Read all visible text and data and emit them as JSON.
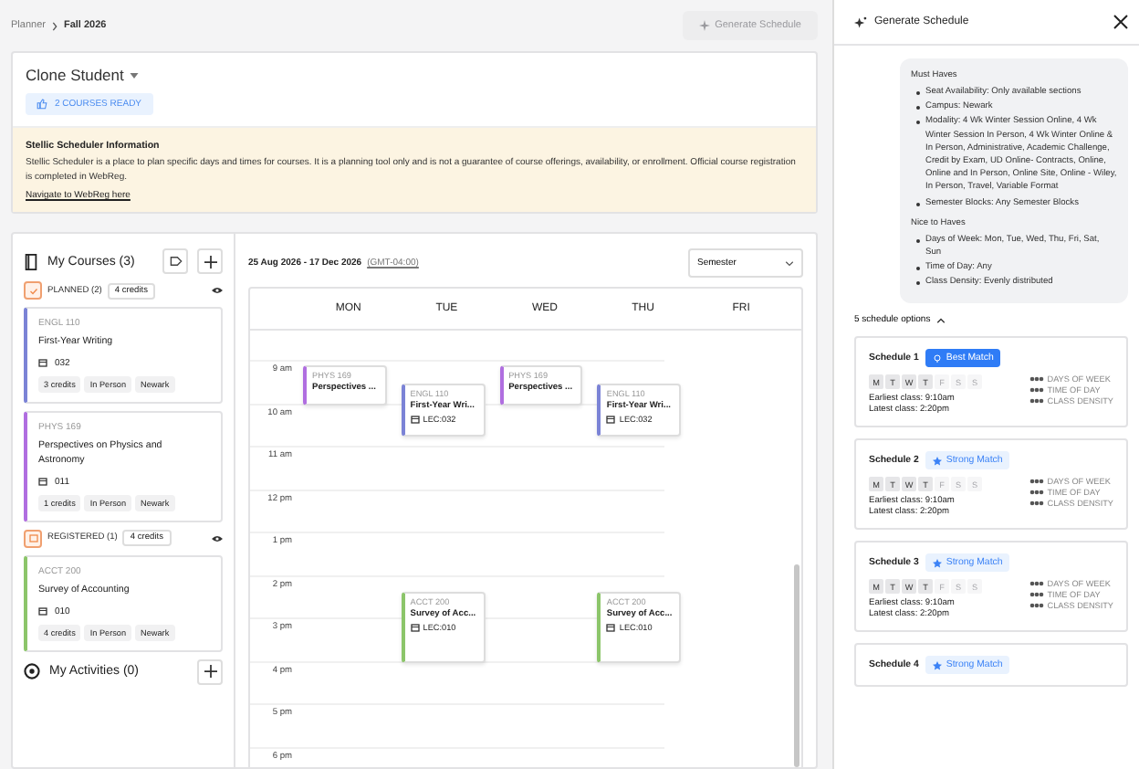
{
  "breadcrumb": {
    "parent": "Planner",
    "current": "Fall 2026"
  },
  "generate_button": {
    "label": "Generate Schedule",
    "disabled": true
  },
  "student": {
    "name": "Clone Student",
    "badge": "2 COURSES READY"
  },
  "info": {
    "title": "Stellic Scheduler Information",
    "text": "Stellic Scheduler is a place to plan specific days and times for courses. It is a planning tool only and is not a guarantee of course offerings, availability, or enrollment. Official course registration is completed in WebReg.",
    "link": "Navigate to WebReg here"
  },
  "my_courses": {
    "title": "My Courses (3)",
    "groups": [
      {
        "kind": "planned",
        "label": "PLANNED (2)",
        "credits": "4 credits",
        "visible": true,
        "courses": [
          {
            "code": "ENGL 110",
            "title": "First-Year Writing",
            "section": "032",
            "tags": [
              "3 credits",
              "In Person",
              "Newark"
            ],
            "color": "#7b83d6"
          },
          {
            "code": "PHYS 169",
            "title": "Perspectives on Physics and Astronomy",
            "section": "011",
            "tags": [
              "1 credits",
              "In Person",
              "Newark"
            ],
            "color": "#b06ee0"
          }
        ]
      },
      {
        "kind": "registered",
        "label": "REGISTERED (1)",
        "credits": "4 credits",
        "visible": true,
        "courses": [
          {
            "code": "ACCT 200",
            "title": "Survey of Accounting",
            "section": "010",
            "tags": [
              "4 credits",
              "In Person",
              "Newark"
            ],
            "color": "#8cc56a"
          }
        ]
      }
    ]
  },
  "activities": {
    "title": "My Activities (0)"
  },
  "calendar": {
    "range": "25 Aug 2026 - 17 Dec 2026",
    "timezone": "(GMT-04:00)",
    "view": "Semester",
    "times": [
      "9 am",
      "10 am",
      "11 am",
      "12 pm",
      "1 pm",
      "2 pm",
      "3 pm",
      "4 pm",
      "5 pm",
      "6 pm"
    ],
    "days": [
      {
        "label": "MON",
        "events": [
          {
            "code": "PHYS 169",
            "title": "Perspectives ...",
            "color": "#b06ee0"
          }
        ]
      },
      {
        "label": "TUE",
        "events": [
          {
            "code": "ENGL 110",
            "title": "First-Year Wri...",
            "location": "LEC:032",
            "color": "#7b83d6"
          },
          {
            "code": "ACCT 200",
            "title": "Survey of Acc...",
            "location": "LEC:010",
            "color": "#8cc56a"
          }
        ]
      },
      {
        "label": "WED",
        "events": [
          {
            "code": "PHYS 169",
            "title": "Perspectives ...",
            "color": "#b06ee0"
          }
        ]
      },
      {
        "label": "THU",
        "events": [
          {
            "code": "ENGL 110",
            "title": "First-Year Wri...",
            "location": "LEC:032",
            "color": "#7b83d6"
          },
          {
            "code": "ACCT 200",
            "title": "Survey of Acc...",
            "location": "LEC:010",
            "color": "#8cc56a"
          }
        ]
      },
      {
        "label": "FRI"
      }
    ]
  },
  "panel": {
    "title": "Generate Schedule",
    "criteria": [
      {
        "heading": "Must Haves",
        "items": [
          "Seat Availability: Only available sections",
          "Campus: Newark",
          "Modality: 4 Wk Winter Session Online, 4 Wk Winter Session In Person, 4 Wk Winter Online & In Person, Administrative, Academic Challenge, Credit by Exam, UD Online- Contracts, Online, Online and In Person, Online Site, Online - Wiley, In Person, Travel, Variable Format",
          "Semester Blocks: Any Semester Blocks"
        ]
      },
      {
        "heading": "Nice to Haves",
        "items": [
          "Days of Week: Mon, Tue, Wed, Thu, Fri, Sat, Sun",
          "Time of Day: Any",
          "Class Density: Evenly distributed"
        ]
      }
    ],
    "options_label": "5 schedule options",
    "options_expanded": true,
    "schedules": [
      {
        "title": "Schedule 1",
        "badge": "Best Match",
        "kind": "best",
        "days": [
          {
            "label": "M",
            "on": true
          },
          {
            "label": "T",
            "on": true
          },
          {
            "label": "W",
            "on": true
          },
          {
            "label": "T",
            "on": true
          },
          {
            "label": "F",
            "on": false
          },
          {
            "label": "S",
            "on": false
          },
          {
            "label": "S",
            "on": false
          }
        ],
        "earliest": "Earliest class: 9:10am",
        "latest": "Latest class: 2:20pm",
        "metrics": [
          "DAYS OF WEEK",
          "TIME OF DAY",
          "CLASS DENSITY"
        ]
      },
      {
        "title": "Schedule 2",
        "badge": "Strong Match",
        "kind": "strong",
        "days": [
          {
            "label": "M",
            "on": true
          },
          {
            "label": "T",
            "on": true
          },
          {
            "label": "W",
            "on": true
          },
          {
            "label": "T",
            "on": true
          },
          {
            "label": "F",
            "on": false
          },
          {
            "label": "S",
            "on": false
          },
          {
            "label": "S",
            "on": false
          }
        ],
        "earliest": "Earliest class: 9:10am",
        "latest": "Latest class: 2:20pm",
        "metrics": [
          "DAYS OF WEEK",
          "TIME OF DAY",
          "CLASS DENSITY"
        ]
      },
      {
        "title": "Schedule 3",
        "badge": "Strong Match",
        "kind": "strong",
        "days": [
          {
            "label": "M",
            "on": true
          },
          {
            "label": "T",
            "on": true
          },
          {
            "label": "W",
            "on": true
          },
          {
            "label": "T",
            "on": true
          },
          {
            "label": "F",
            "on": false
          },
          {
            "label": "S",
            "on": false
          },
          {
            "label": "S",
            "on": false
          }
        ],
        "earliest": "Earliest class: 9:10am",
        "latest": "Latest class: 2:20pm",
        "metrics": [
          "DAYS OF WEEK",
          "TIME OF DAY",
          "CLASS DENSITY"
        ]
      },
      {
        "title": "Schedule 4",
        "badge": "Strong Match",
        "kind": "strong"
      }
    ]
  }
}
